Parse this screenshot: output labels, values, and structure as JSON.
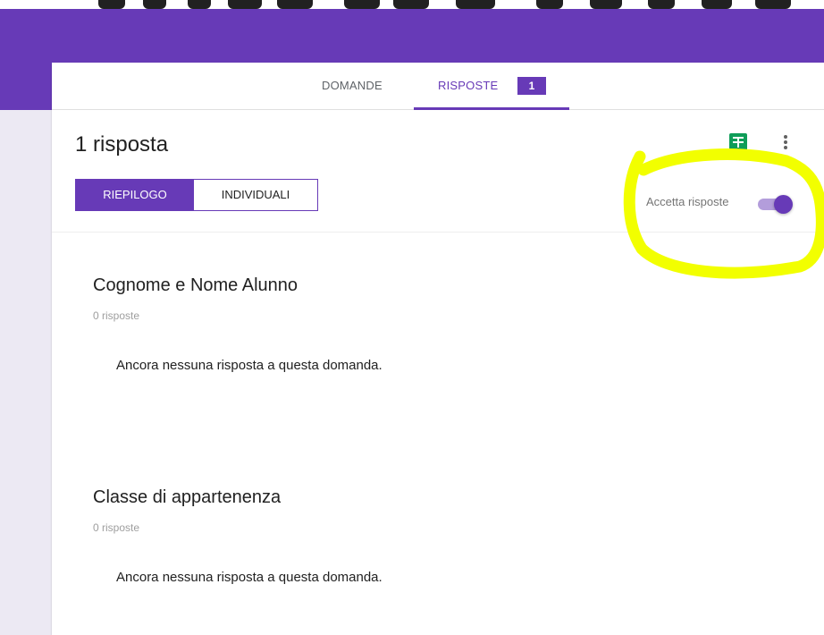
{
  "nav": {
    "tabs": [
      {
        "label": "DOMANDE"
      },
      {
        "label": "RISPOSTE",
        "badge": "1"
      }
    ]
  },
  "summary": {
    "response_count_label": "1 risposta",
    "segments": [
      {
        "label": "RIEPILOGO",
        "selected": true
      },
      {
        "label": "INDIVIDUALI",
        "selected": false
      }
    ],
    "accept_responses": {
      "label": "Accetta risposte",
      "enabled": true
    },
    "icons": [
      "sheets-icon",
      "more-vert-icon"
    ]
  },
  "questions": [
    {
      "title": "Cognome e Nome Alunno",
      "count_label": "0 risposte",
      "empty_message": "Ancora nessuna risposta a questa domanda."
    },
    {
      "title": "Classe di appartenenza",
      "count_label": "0 risposte",
      "empty_message": "Ancora nessuna risposta a questa domanda."
    }
  ],
  "colors": {
    "brand": "#673ab7",
    "brand_light": "#b39ddb",
    "background": "#ece9f3",
    "sheets_green": "#0f9d58",
    "highlight_yellow": "#f2ff00"
  }
}
